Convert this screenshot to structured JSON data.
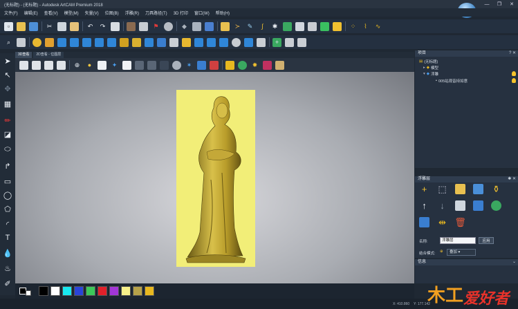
{
  "window": {
    "title": "(无标题) - (无标题) - Autodesk ArtCAM Premium 2018",
    "controls": [
      "—",
      "❐",
      "✕"
    ]
  },
  "logo_badge": "ArtCAM",
  "menu": [
    "文件(F)",
    "编辑(E)",
    "查看(V)",
    "模型(M)",
    "矢量(V)",
    "位图(B)",
    "浮雕(R)",
    "刀具路径(T)",
    "3D 打印",
    "窗口(W)",
    "帮助(H)"
  ],
  "view_tabs": [
    "3D查看",
    "2D查看 - 位图层"
  ],
  "palette_colors": [
    "#000000",
    "#ffffff",
    "#18e8f0",
    "#2a44d8",
    "#3cc85a",
    "#e0202a",
    "#a236d6",
    "#f6f08a",
    "#b6a24a",
    "#e8b820"
  ],
  "status": {
    "x": "X: 410.860",
    "y": "Y: 177.142"
  },
  "project_panel": {
    "title": "项目",
    "tree": [
      {
        "label": "(无标题)",
        "level": 0
      },
      {
        "label": "模型",
        "level": 1
      },
      {
        "label": "浮雕",
        "level": 1
      },
      {
        "label": "005站观音持如意",
        "level": 2
      }
    ]
  },
  "layer_panel": {
    "title": "浮雕层",
    "name_label": "名称:",
    "name_value": "浮雕层",
    "apply": "应用",
    "mode_label": "结合模式:",
    "mode_value": "叠加"
  },
  "info_panel": {
    "title": "信息"
  },
  "watermark": {
    "text": "爱好者",
    "prefix": "木工"
  }
}
